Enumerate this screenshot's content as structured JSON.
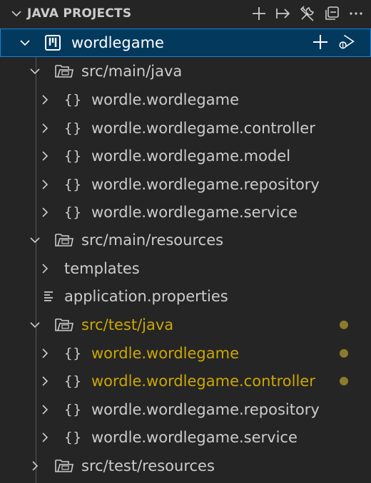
{
  "section": {
    "title": "JAVA PROJECTS"
  },
  "header_actions": [
    {
      "icon": "plus-icon"
    },
    {
      "icon": "export-jar-icon"
    },
    {
      "icon": "tools-icon"
    },
    {
      "icon": "collapse-all-icon"
    },
    {
      "icon": "more-actions-icon"
    }
  ],
  "project": {
    "label": "wordlegame",
    "row_actions": [
      "plus-icon",
      "run-debug-icon"
    ]
  },
  "tree": [
    {
      "label": "src/main/java"
    },
    {
      "label": "wordle.wordlegame"
    },
    {
      "label": "wordle.wordlegame.controller"
    },
    {
      "label": "wordle.wordlegame.model"
    },
    {
      "label": "wordle.wordlegame.repository"
    },
    {
      "label": "wordle.wordlegame.service"
    },
    {
      "label": "src/main/resources"
    },
    {
      "label": "templates"
    },
    {
      "label": "application.properties"
    },
    {
      "label": "src/test/java",
      "modified": true
    },
    {
      "label": "wordle.wordlegame",
      "modified": true
    },
    {
      "label": "wordle.wordlegame.controller",
      "modified": true
    },
    {
      "label": "wordle.wordlegame.repository"
    },
    {
      "label": "wordle.wordlegame.service"
    },
    {
      "label": "src/test/resources"
    }
  ],
  "package_icon_text": "{}",
  "colors": {
    "modified": "#cca700",
    "modified_dot": "#8b7b2c",
    "selection": "#04395e",
    "focus_border": "#1384d4"
  }
}
